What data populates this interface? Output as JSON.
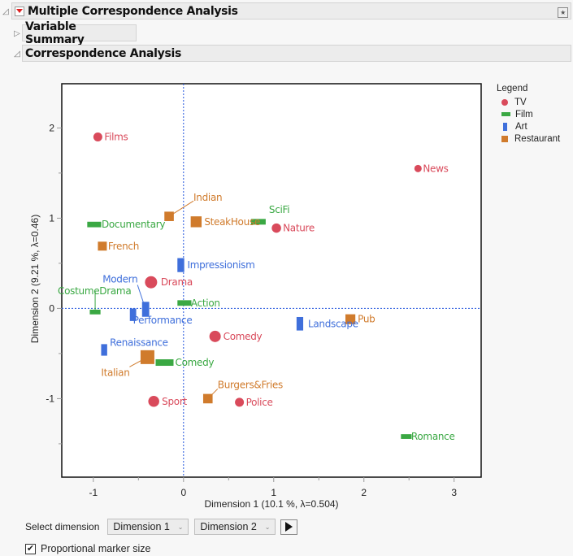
{
  "report": {
    "title": "Multiple Correspondence Analysis",
    "sections": [
      {
        "label": "Variable Summary",
        "expanded": false
      },
      {
        "label": "Correspondence Analysis",
        "expanded": true
      }
    ]
  },
  "colors": {
    "TV": "#d94a5b",
    "Film": "#3aa843",
    "Art": "#3f6fdb",
    "Restaurant": "#d07b2c",
    "refline": "#2255dd"
  },
  "legend": {
    "title": "Legend",
    "items": [
      {
        "label": "TV",
        "marker": "circle"
      },
      {
        "label": "Film",
        "marker": "horizontal-bar"
      },
      {
        "label": "Art",
        "marker": "vertical-bar"
      },
      {
        "label": "Restaurant",
        "marker": "square"
      }
    ]
  },
  "chart_data": {
    "type": "scatter",
    "title": "",
    "xlabel": "Dimension 1  (10.1 %, λ=0.504)",
    "ylabel": "Dimension 2  (9.21 %, λ=0.46)",
    "xlim": [
      -1.35,
      3.3
    ],
    "ylim": [
      -1.87,
      2.49
    ],
    "xticks": [
      -1,
      0,
      1,
      2,
      3
    ],
    "yticks": [
      -1,
      0,
      1,
      2
    ],
    "reference_lines": {
      "x": 0,
      "y": 0
    },
    "grid": false,
    "legend_position": "right",
    "series": [
      {
        "name": "TV",
        "points": [
          {
            "label": "Films",
            "x": -0.95,
            "y": 1.9,
            "size": 0.5
          },
          {
            "label": "News",
            "x": 2.6,
            "y": 1.55,
            "size": 0.3
          },
          {
            "label": "Nature",
            "x": 1.03,
            "y": 0.89,
            "size": 0.55
          },
          {
            "label": "Drama",
            "x": -0.36,
            "y": 0.29,
            "size": 0.9
          },
          {
            "label": "Comedy",
            "x": 0.35,
            "y": -0.31,
            "size": 0.8
          },
          {
            "label": "Sport",
            "x": -0.33,
            "y": -1.03,
            "size": 0.75
          },
          {
            "label": "Police",
            "x": 0.62,
            "y": -1.04,
            "size": 0.5
          }
        ]
      },
      {
        "name": "Film",
        "points": [
          {
            "label": "Documentary",
            "x": -0.99,
            "y": 0.93,
            "size": 0.7
          },
          {
            "label": "SciFi",
            "x": 0.83,
            "y": 0.96,
            "size": 0.75
          },
          {
            "label": "Action",
            "x": 0.01,
            "y": 0.06,
            "size": 0.7
          },
          {
            "label": "CostumeDrama",
            "x": -0.98,
            "y": -0.04,
            "size": 0.45
          },
          {
            "label": "Comedy",
            "x": -0.21,
            "y": -0.6,
            "size": 1.0
          },
          {
            "label": "Romance",
            "x": 2.47,
            "y": -1.42,
            "size": 0.45
          }
        ]
      },
      {
        "name": "Art",
        "points": [
          {
            "label": "Impressionism",
            "x": -0.03,
            "y": 0.48,
            "size": 0.85
          },
          {
            "label": "Modern",
            "x": -0.42,
            "y": -0.01,
            "size": 0.95
          },
          {
            "label": "Performance",
            "x": -0.56,
            "y": -0.07,
            "size": 0.7
          },
          {
            "label": "Renaissance",
            "x": -0.88,
            "y": -0.46,
            "size": 0.6
          },
          {
            "label": "Landscape",
            "x": 1.29,
            "y": -0.17,
            "size": 0.8
          }
        ]
      },
      {
        "name": "Restaurant",
        "points": [
          {
            "label": "Indian",
            "x": -0.16,
            "y": 1.02,
            "size": 0.55
          },
          {
            "label": "SteakHouse",
            "x": 0.14,
            "y": 0.96,
            "size": 0.7
          },
          {
            "label": "French",
            "x": -0.9,
            "y": 0.69,
            "size": 0.5
          },
          {
            "label": "Italian",
            "x": -0.4,
            "y": -0.54,
            "size": 1.0
          },
          {
            "label": "Pub",
            "x": 1.85,
            "y": -0.12,
            "size": 0.6
          },
          {
            "label": "Burgers&Fries",
            "x": 0.27,
            "y": -1.0,
            "size": 0.55
          }
        ]
      }
    ]
  },
  "controls": {
    "select_label": "Select dimension",
    "x_dimension": "Dimension 1",
    "y_dimension": "Dimension 2",
    "proportional_label": "Proportional marker size",
    "proportional_checked": true
  }
}
